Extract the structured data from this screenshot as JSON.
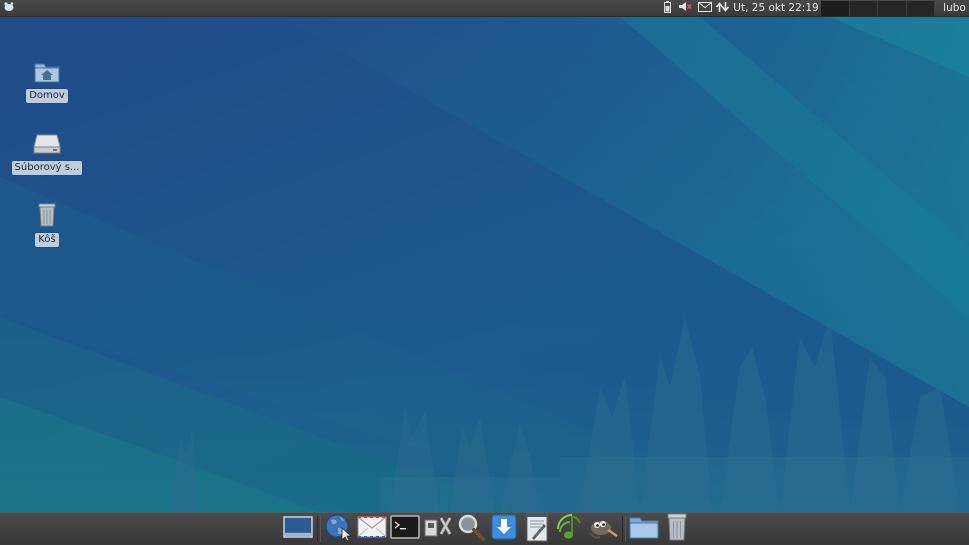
{
  "top_panel": {
    "clock": "Ut, 25 okt  22:19",
    "user": "lubo",
    "workspaces_count": 4,
    "tray_icons": [
      "battery-icon",
      "volume-muted-icon",
      "mail-icon",
      "network-icon"
    ]
  },
  "desktop": {
    "icons": [
      {
        "label": "Domov",
        "icon": "home-folder-icon"
      },
      {
        "label": "Súborový s...",
        "icon": "drive-icon"
      },
      {
        "label": "Kôš",
        "icon": "trash-icon"
      }
    ]
  },
  "dock": {
    "items": [
      "show-desktop-icon",
      "web-browser-icon",
      "mail-client-icon",
      "terminal-icon",
      "settings-manager-icon",
      "search-icon",
      "download-icon",
      "text-editor-icon",
      "music-player-icon",
      "image-editor-icon",
      "file-manager-icon",
      "trash-icon"
    ]
  },
  "colors": {
    "panel": "#3e3e3e",
    "desktop_blue": "#1f5a8e",
    "desktop_teal": "#1a6f93",
    "label_bg": "#d8dee4"
  }
}
